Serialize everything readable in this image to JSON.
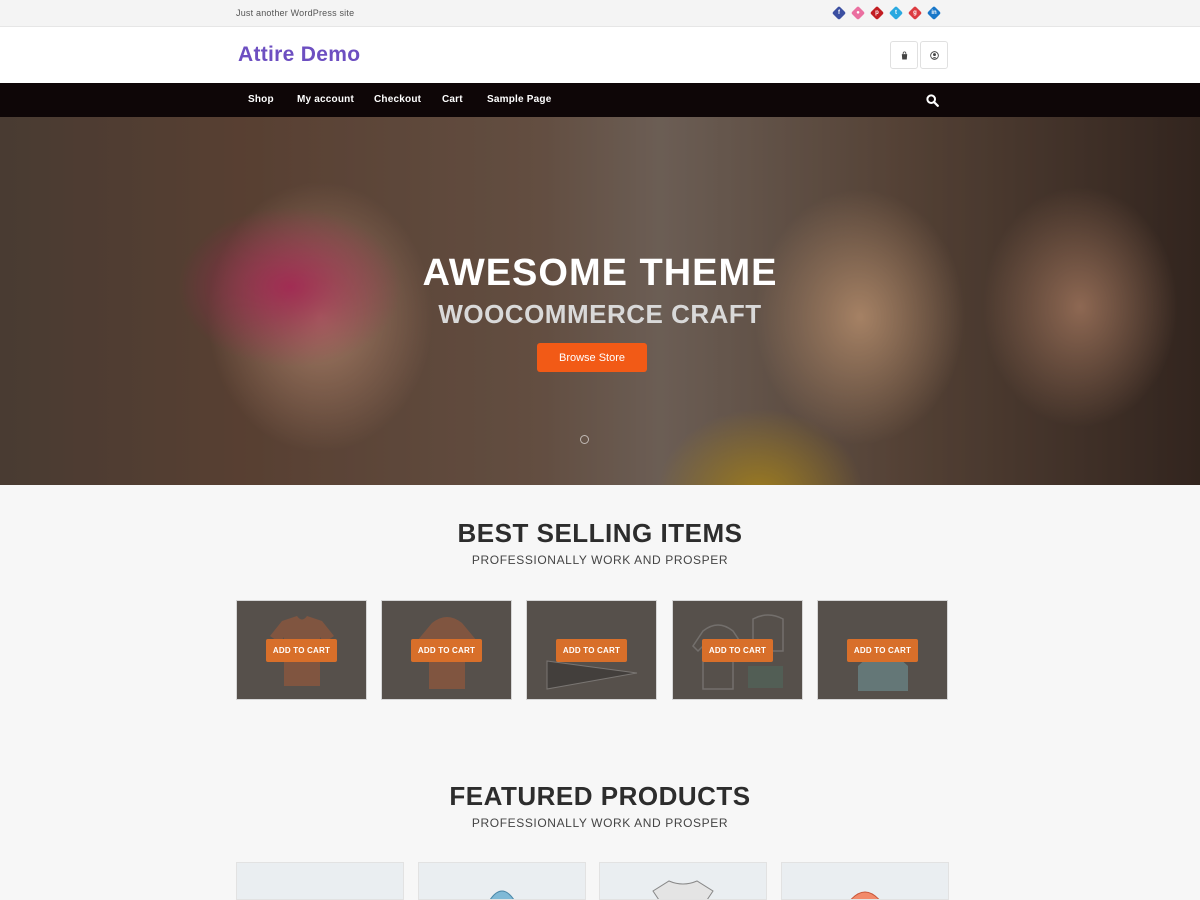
{
  "topbar": {
    "tagline": "Just another WordPress site",
    "social": [
      {
        "icon": "facebook-icon",
        "color": "#3b4fa1",
        "glyph": "f"
      },
      {
        "icon": "dribbble-icon",
        "color": "#ea6fa0",
        "glyph": "d"
      },
      {
        "icon": "pinterest-icon",
        "color": "#c21d22",
        "glyph": "p"
      },
      {
        "icon": "twitter-icon",
        "color": "#2aa9e0",
        "glyph": "t"
      },
      {
        "icon": "google-plus-icon",
        "color": "#dc3b40",
        "glyph": "g"
      },
      {
        "icon": "linkedin-icon",
        "color": "#1877c9",
        "glyph": "in"
      }
    ]
  },
  "header": {
    "site_title": "Attire Demo",
    "cart_icon": "cart-bag-icon",
    "account_icon": "user-icon",
    "brand_color": "#6d4fc1"
  },
  "nav": {
    "items": [
      "Shop",
      "My account",
      "Checkout",
      "Cart",
      "Sample Page"
    ],
    "search_icon": "search-icon"
  },
  "hero": {
    "title": "AWESOME THEME",
    "subtitle": "WOOCOMMERCE CRAFT",
    "button": "Browse Store",
    "button_color": "#f25a16"
  },
  "best_selling": {
    "title": "BEST SELLING ITEMS",
    "subtitle": "PROFESSIONALLY WORK AND PROSPER",
    "items": [
      {
        "button": "ADD TO CART",
        "image": "t-shirt-icon"
      },
      {
        "button": "ADD TO CART",
        "image": "hoodie-icon"
      },
      {
        "button": "ADD TO CART",
        "image": "pennant-icon"
      },
      {
        "button": "ADD TO CART",
        "image": "hoodie-beanie-icon"
      },
      {
        "button": "ADD TO CART",
        "image": "beanie-icon"
      }
    ],
    "button_color": "#d86f2a"
  },
  "featured": {
    "title": "FEATURED PRODUCTS",
    "subtitle": "PROFESSIONALLY WORK AND PROSPER",
    "items": [
      {
        "image": "blank-product"
      },
      {
        "image": "blue-beanie-icon"
      },
      {
        "image": "gray-tshirt-icon"
      },
      {
        "image": "orange-cap-icon"
      }
    ]
  }
}
